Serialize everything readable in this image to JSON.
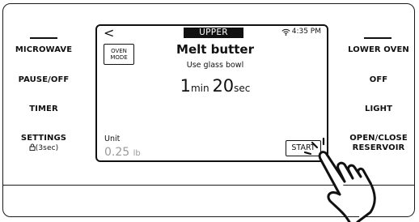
{
  "left_buttons": [
    {
      "label": "MICROWAVE",
      "sub": ""
    },
    {
      "label": "PAUSE/OFF",
      "sub": ""
    },
    {
      "label": "TIMER",
      "sub": ""
    },
    {
      "label": "SETTINGS",
      "sub": "(3sec)"
    }
  ],
  "right_buttons": [
    {
      "label": "LOWER OVEN"
    },
    {
      "label": "OFF"
    },
    {
      "label": "LIGHT"
    },
    {
      "label": "OPEN/CLOSE",
      "label2": "RESERVOIR"
    }
  ],
  "screen": {
    "back_glyph": "<",
    "tab": "UPPER",
    "time_of_day": "4:35 PM",
    "oven_mode_line1": "OVEN",
    "oven_mode_line2": "MODE",
    "title": "Melt butter",
    "subtitle": "Use glass bowl",
    "minutes": "1",
    "min_unit": "min",
    "seconds": "20",
    "sec_unit": "sec",
    "unit_label": "Unit",
    "unit_value": "0.25",
    "unit_suffix": "lb",
    "start_label": "START"
  },
  "icons": {
    "wifi": "wifi-icon",
    "lock": "lock-icon",
    "hand": "pointing-hand-icon"
  }
}
